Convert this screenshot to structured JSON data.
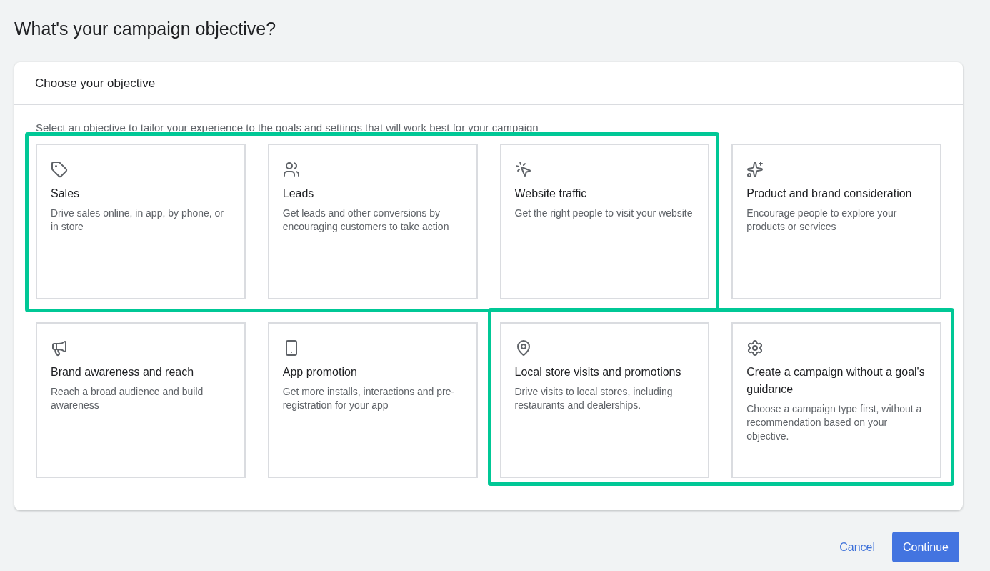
{
  "page_title": "What's your campaign objective?",
  "panel": {
    "title": "Choose your objective",
    "instruction": "Select an objective to tailor your experience to the goals and settings that will work best for your campaign",
    "objectives": [
      {
        "title": "Sales",
        "description": "Drive sales online, in app, by phone, or in store"
      },
      {
        "title": "Leads",
        "description": "Get leads and other conversions by encouraging customers to take action"
      },
      {
        "title": "Website traffic",
        "description": "Get the right people to visit your website"
      },
      {
        "title": "Product and brand consideration",
        "description": "Encourage people to explore your products or services"
      },
      {
        "title": "Brand awareness and reach",
        "description": "Reach a broad audience and build awareness"
      },
      {
        "title": "App promotion",
        "description": "Get more installs, interactions and pre-registration for your app"
      },
      {
        "title": "Local store visits and promotions",
        "description": "Drive visits to local stores, including restaurants and dealerships."
      },
      {
        "title": "Create a campaign without a goal's guidance",
        "description": "Choose a campaign type first, without a recommendation based on your objective."
      }
    ]
  },
  "buttons": {
    "cancel": "Cancel",
    "continue": "Continue"
  }
}
